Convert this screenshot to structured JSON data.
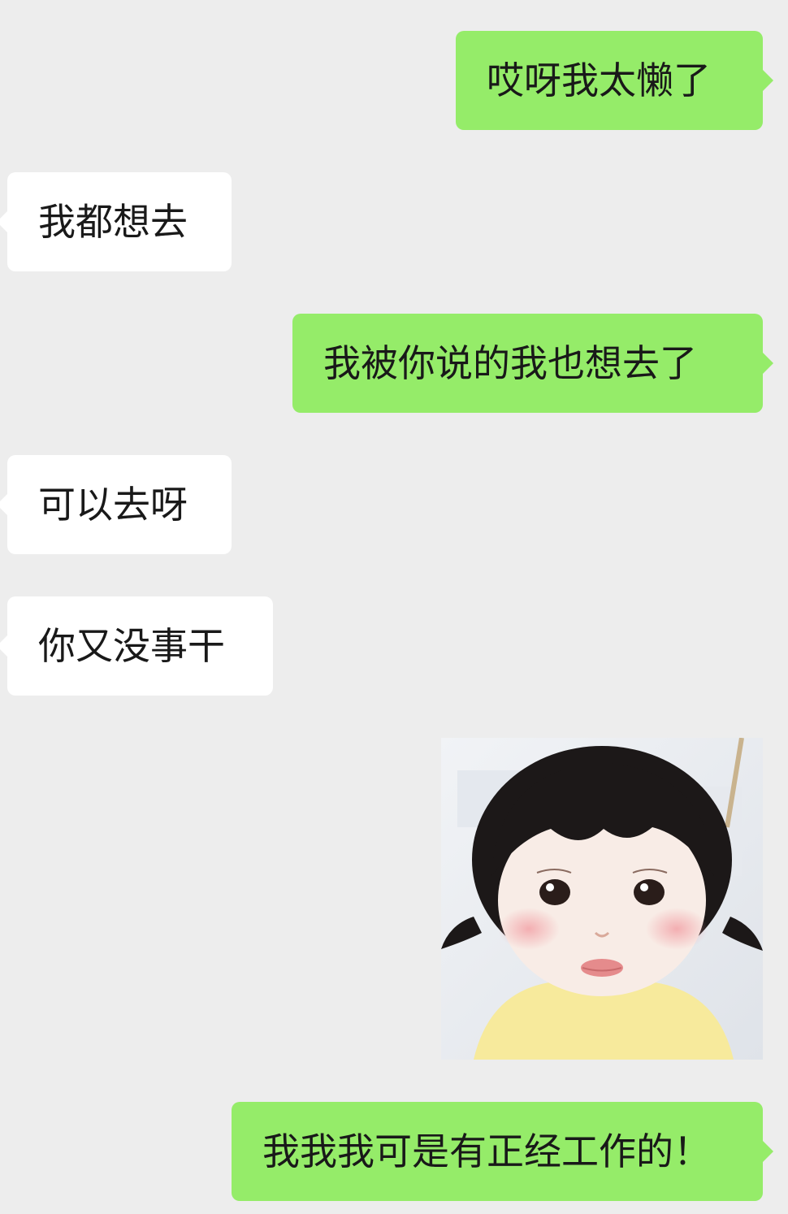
{
  "messages": [
    {
      "id": "m1",
      "side": "sent",
      "text": "哎呀我太懒了"
    },
    {
      "id": "m2",
      "side": "received",
      "text": "我都想去"
    },
    {
      "id": "m3",
      "side": "sent",
      "text": "我被你说的我也想去了"
    },
    {
      "id": "m4",
      "side": "received",
      "text": "可以去呀"
    },
    {
      "id": "m5",
      "side": "received",
      "text": "你又没事干"
    },
    {
      "id": "m6",
      "side": "sent",
      "type": "sticker",
      "sticker": "toddler-face-sticker"
    },
    {
      "id": "m7",
      "side": "sent",
      "text": "我我我可是有正经工作的！"
    }
  ],
  "colors": {
    "background": "#ededed",
    "sent_bubble": "#95ec69",
    "received_bubble": "#ffffff",
    "text": "#191919"
  }
}
